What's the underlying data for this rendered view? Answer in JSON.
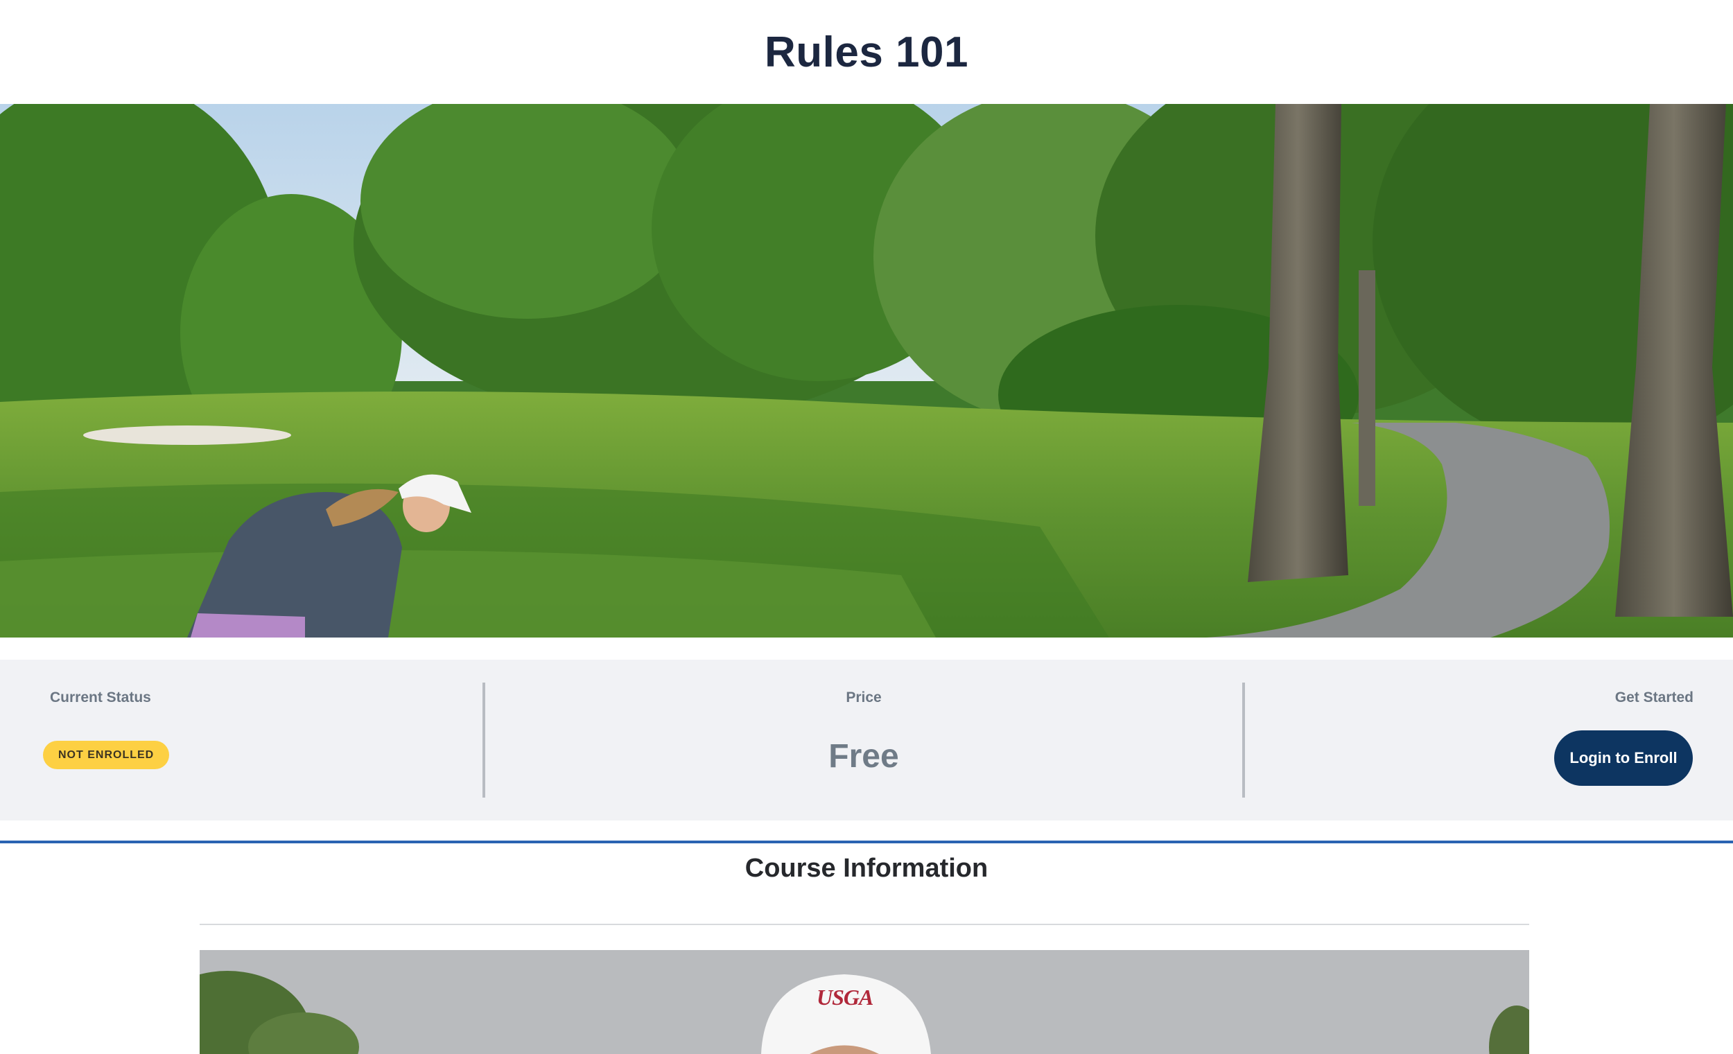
{
  "page": {
    "title": "Rules 101"
  },
  "hero": {
    "alt": "Golfer on a tree-lined golf course fairway"
  },
  "status_bar": {
    "current_status": {
      "label": "Current Status",
      "badge": "NOT ENROLLED",
      "badge_color": "#fdd043"
    },
    "price": {
      "label": "Price",
      "value": "Free"
    },
    "get_started": {
      "label": "Get Started",
      "button_label": "Login to Enroll",
      "button_color": "#0d3561"
    }
  },
  "course_info": {
    "title": "Course Information",
    "rule_color": "#2a63b2",
    "image": {
      "cap_logo": "USGA"
    }
  }
}
